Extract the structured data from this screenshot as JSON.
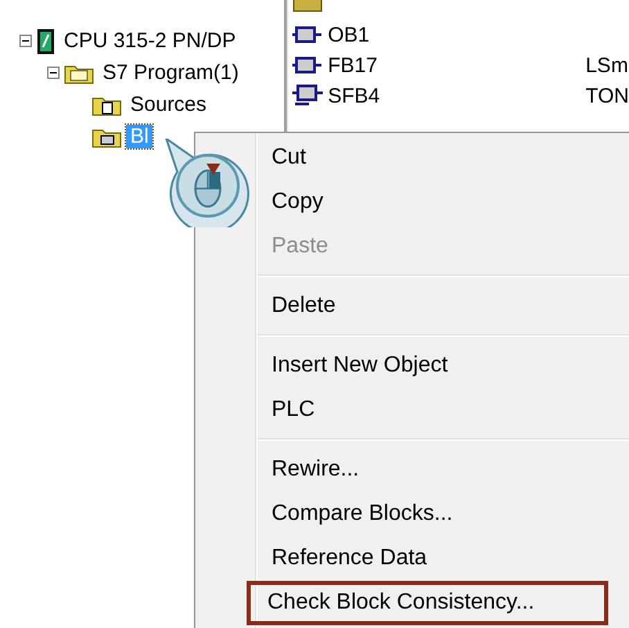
{
  "tree": [
    {
      "label": "CPU 315-2 PN/DP",
      "kind": "cpu",
      "expanded": true,
      "selected": false,
      "children": [
        {
          "label": "S7 Program(1)",
          "kind": "program",
          "expanded": true,
          "selected": false,
          "children": [
            {
              "label": "Sources",
              "kind": "sources",
              "selected": false
            },
            {
              "label": "Bl",
              "kind": "blocks",
              "selected": true
            }
          ]
        }
      ]
    }
  ],
  "list": [
    {
      "kind": "folder"
    },
    {
      "kind": "block",
      "name": "OB1"
    },
    {
      "kind": "block",
      "name": "FB17",
      "comment": "LSm"
    },
    {
      "kind": "system",
      "name": "SFB4",
      "comment": "TON"
    }
  ],
  "context_menu": [
    {
      "kind": "item",
      "label": "Cut",
      "disabled": false,
      "selected": false
    },
    {
      "kind": "item",
      "label": "Copy",
      "disabled": false,
      "selected": false
    },
    {
      "kind": "item",
      "label": "Paste",
      "disabled": true,
      "selected": false
    },
    {
      "kind": "separator"
    },
    {
      "kind": "item",
      "label": "Delete",
      "disabled": false,
      "selected": false
    },
    {
      "kind": "separator"
    },
    {
      "kind": "item",
      "label": "Insert New Object",
      "disabled": false,
      "selected": false
    },
    {
      "kind": "item",
      "label": "PLC",
      "disabled": false,
      "selected": false
    },
    {
      "kind": "separator"
    },
    {
      "kind": "item",
      "label": "Rewire...",
      "disabled": false,
      "selected": false
    },
    {
      "kind": "item",
      "label": "Compare Blocks...",
      "disabled": false,
      "selected": false
    },
    {
      "kind": "item",
      "label": "Reference Data",
      "disabled": false,
      "selected": false
    },
    {
      "kind": "item",
      "label": "Check Block Consistency...",
      "disabled": false,
      "selected": true
    }
  ]
}
